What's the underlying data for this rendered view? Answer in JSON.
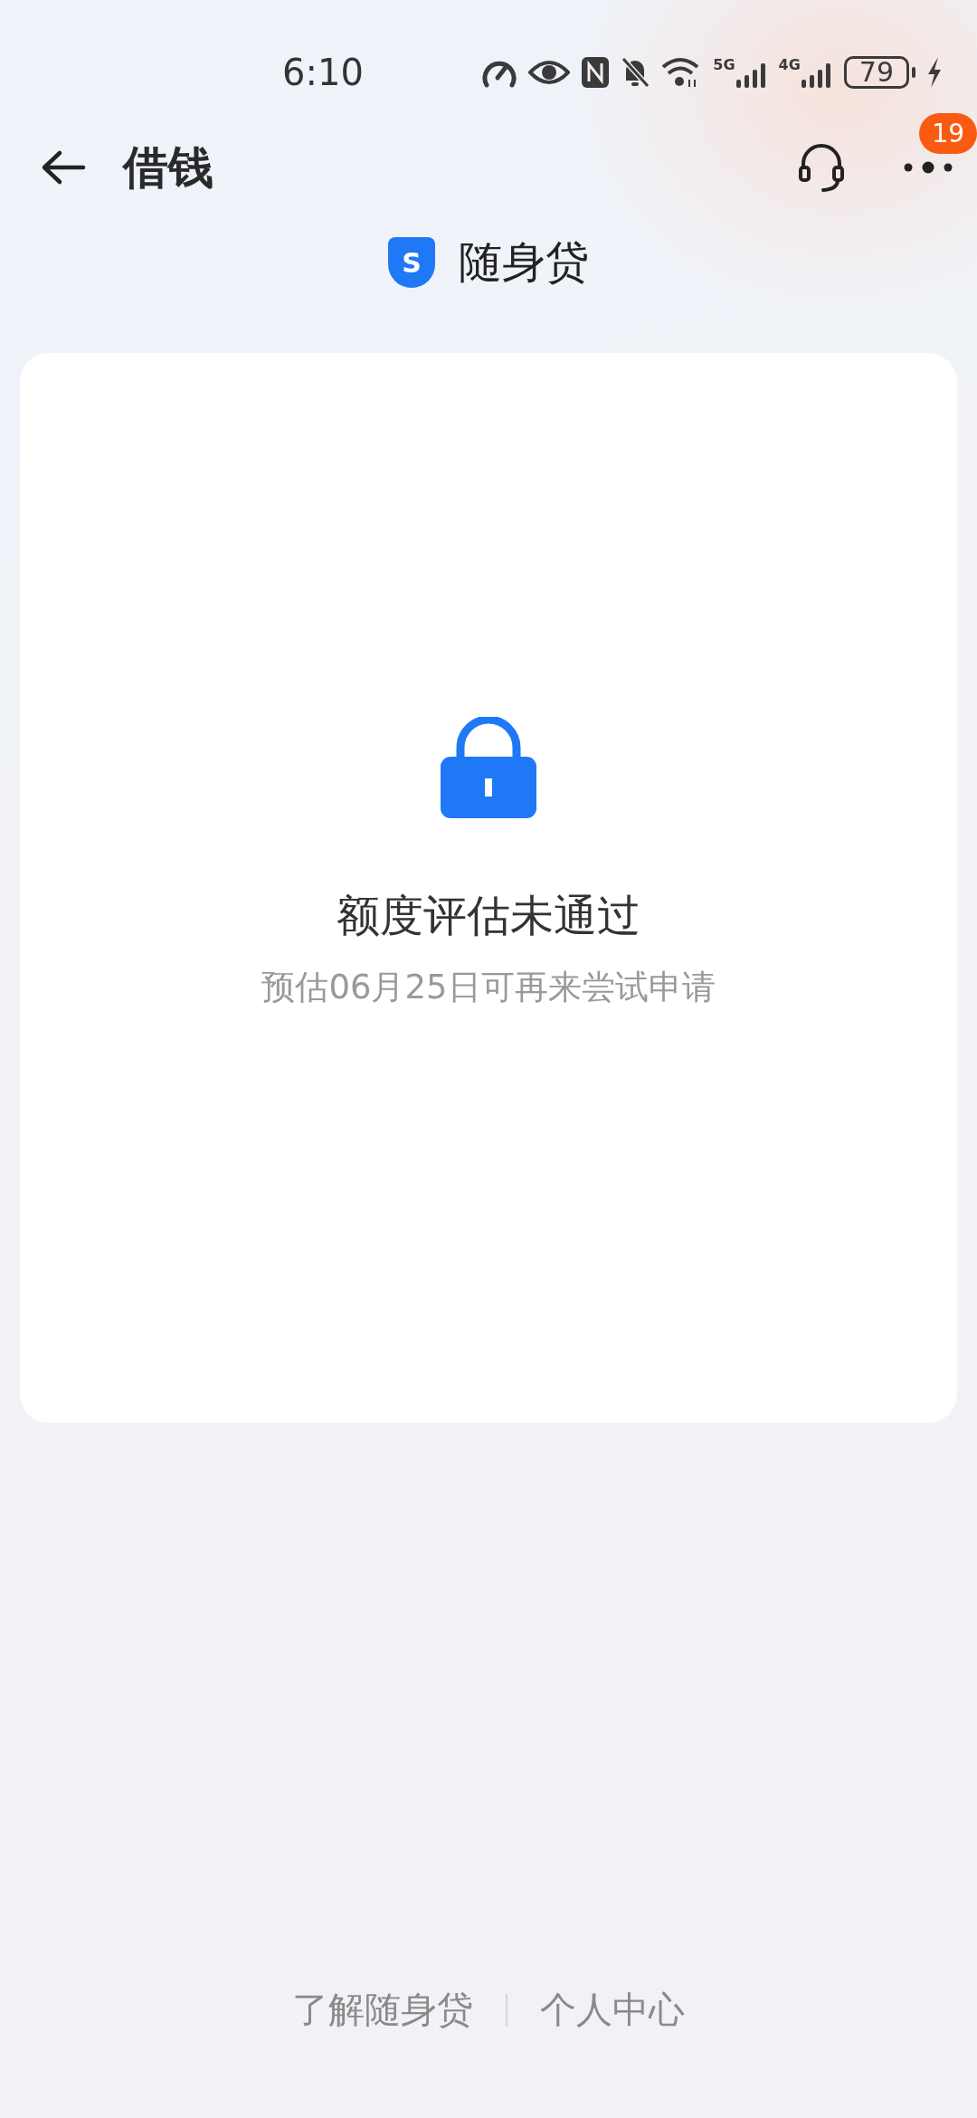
{
  "status_bar": {
    "time": "6:10",
    "networks": [
      "5G",
      "4G"
    ],
    "battery": "79"
  },
  "header": {
    "title": "借钱",
    "badge": "19"
  },
  "brand": {
    "name": "随身贷",
    "logo_letter": "S"
  },
  "card": {
    "title": "额度评估未通过",
    "subtitle": "预估06月25日可再来尝试申请"
  },
  "footer": {
    "links": [
      "了解随身贷",
      "个人中心"
    ]
  }
}
